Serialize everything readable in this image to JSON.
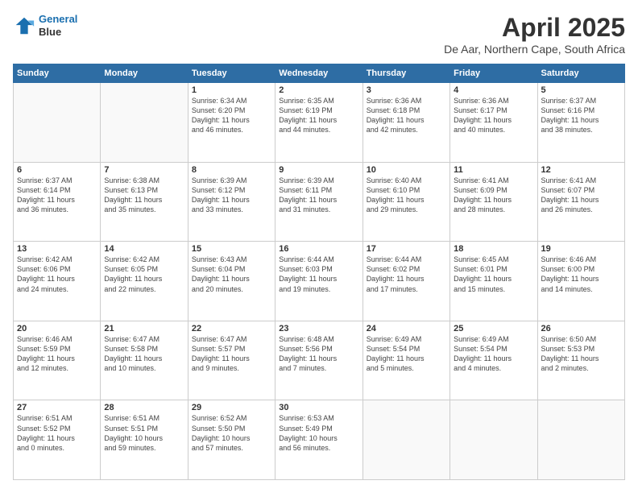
{
  "logo": {
    "line1": "General",
    "line2": "Blue"
  },
  "title": "April 2025",
  "subtitle": "De Aar, Northern Cape, South Africa",
  "weekdays": [
    "Sunday",
    "Monday",
    "Tuesday",
    "Wednesday",
    "Thursday",
    "Friday",
    "Saturday"
  ],
  "weeks": [
    [
      {
        "day": "",
        "info": ""
      },
      {
        "day": "",
        "info": ""
      },
      {
        "day": "1",
        "info": "Sunrise: 6:34 AM\nSunset: 6:20 PM\nDaylight: 11 hours\nand 46 minutes."
      },
      {
        "day": "2",
        "info": "Sunrise: 6:35 AM\nSunset: 6:19 PM\nDaylight: 11 hours\nand 44 minutes."
      },
      {
        "day": "3",
        "info": "Sunrise: 6:36 AM\nSunset: 6:18 PM\nDaylight: 11 hours\nand 42 minutes."
      },
      {
        "day": "4",
        "info": "Sunrise: 6:36 AM\nSunset: 6:17 PM\nDaylight: 11 hours\nand 40 minutes."
      },
      {
        "day": "5",
        "info": "Sunrise: 6:37 AM\nSunset: 6:16 PM\nDaylight: 11 hours\nand 38 minutes."
      }
    ],
    [
      {
        "day": "6",
        "info": "Sunrise: 6:37 AM\nSunset: 6:14 PM\nDaylight: 11 hours\nand 36 minutes."
      },
      {
        "day": "7",
        "info": "Sunrise: 6:38 AM\nSunset: 6:13 PM\nDaylight: 11 hours\nand 35 minutes."
      },
      {
        "day": "8",
        "info": "Sunrise: 6:39 AM\nSunset: 6:12 PM\nDaylight: 11 hours\nand 33 minutes."
      },
      {
        "day": "9",
        "info": "Sunrise: 6:39 AM\nSunset: 6:11 PM\nDaylight: 11 hours\nand 31 minutes."
      },
      {
        "day": "10",
        "info": "Sunrise: 6:40 AM\nSunset: 6:10 PM\nDaylight: 11 hours\nand 29 minutes."
      },
      {
        "day": "11",
        "info": "Sunrise: 6:41 AM\nSunset: 6:09 PM\nDaylight: 11 hours\nand 28 minutes."
      },
      {
        "day": "12",
        "info": "Sunrise: 6:41 AM\nSunset: 6:07 PM\nDaylight: 11 hours\nand 26 minutes."
      }
    ],
    [
      {
        "day": "13",
        "info": "Sunrise: 6:42 AM\nSunset: 6:06 PM\nDaylight: 11 hours\nand 24 minutes."
      },
      {
        "day": "14",
        "info": "Sunrise: 6:42 AM\nSunset: 6:05 PM\nDaylight: 11 hours\nand 22 minutes."
      },
      {
        "day": "15",
        "info": "Sunrise: 6:43 AM\nSunset: 6:04 PM\nDaylight: 11 hours\nand 20 minutes."
      },
      {
        "day": "16",
        "info": "Sunrise: 6:44 AM\nSunset: 6:03 PM\nDaylight: 11 hours\nand 19 minutes."
      },
      {
        "day": "17",
        "info": "Sunrise: 6:44 AM\nSunset: 6:02 PM\nDaylight: 11 hours\nand 17 minutes."
      },
      {
        "day": "18",
        "info": "Sunrise: 6:45 AM\nSunset: 6:01 PM\nDaylight: 11 hours\nand 15 minutes."
      },
      {
        "day": "19",
        "info": "Sunrise: 6:46 AM\nSunset: 6:00 PM\nDaylight: 11 hours\nand 14 minutes."
      }
    ],
    [
      {
        "day": "20",
        "info": "Sunrise: 6:46 AM\nSunset: 5:59 PM\nDaylight: 11 hours\nand 12 minutes."
      },
      {
        "day": "21",
        "info": "Sunrise: 6:47 AM\nSunset: 5:58 PM\nDaylight: 11 hours\nand 10 minutes."
      },
      {
        "day": "22",
        "info": "Sunrise: 6:47 AM\nSunset: 5:57 PM\nDaylight: 11 hours\nand 9 minutes."
      },
      {
        "day": "23",
        "info": "Sunrise: 6:48 AM\nSunset: 5:56 PM\nDaylight: 11 hours\nand 7 minutes."
      },
      {
        "day": "24",
        "info": "Sunrise: 6:49 AM\nSunset: 5:54 PM\nDaylight: 11 hours\nand 5 minutes."
      },
      {
        "day": "25",
        "info": "Sunrise: 6:49 AM\nSunset: 5:54 PM\nDaylight: 11 hours\nand 4 minutes."
      },
      {
        "day": "26",
        "info": "Sunrise: 6:50 AM\nSunset: 5:53 PM\nDaylight: 11 hours\nand 2 minutes."
      }
    ],
    [
      {
        "day": "27",
        "info": "Sunrise: 6:51 AM\nSunset: 5:52 PM\nDaylight: 11 hours\nand 0 minutes."
      },
      {
        "day": "28",
        "info": "Sunrise: 6:51 AM\nSunset: 5:51 PM\nDaylight: 10 hours\nand 59 minutes."
      },
      {
        "day": "29",
        "info": "Sunrise: 6:52 AM\nSunset: 5:50 PM\nDaylight: 10 hours\nand 57 minutes."
      },
      {
        "day": "30",
        "info": "Sunrise: 6:53 AM\nSunset: 5:49 PM\nDaylight: 10 hours\nand 56 minutes."
      },
      {
        "day": "",
        "info": ""
      },
      {
        "day": "",
        "info": ""
      },
      {
        "day": "",
        "info": ""
      }
    ]
  ]
}
